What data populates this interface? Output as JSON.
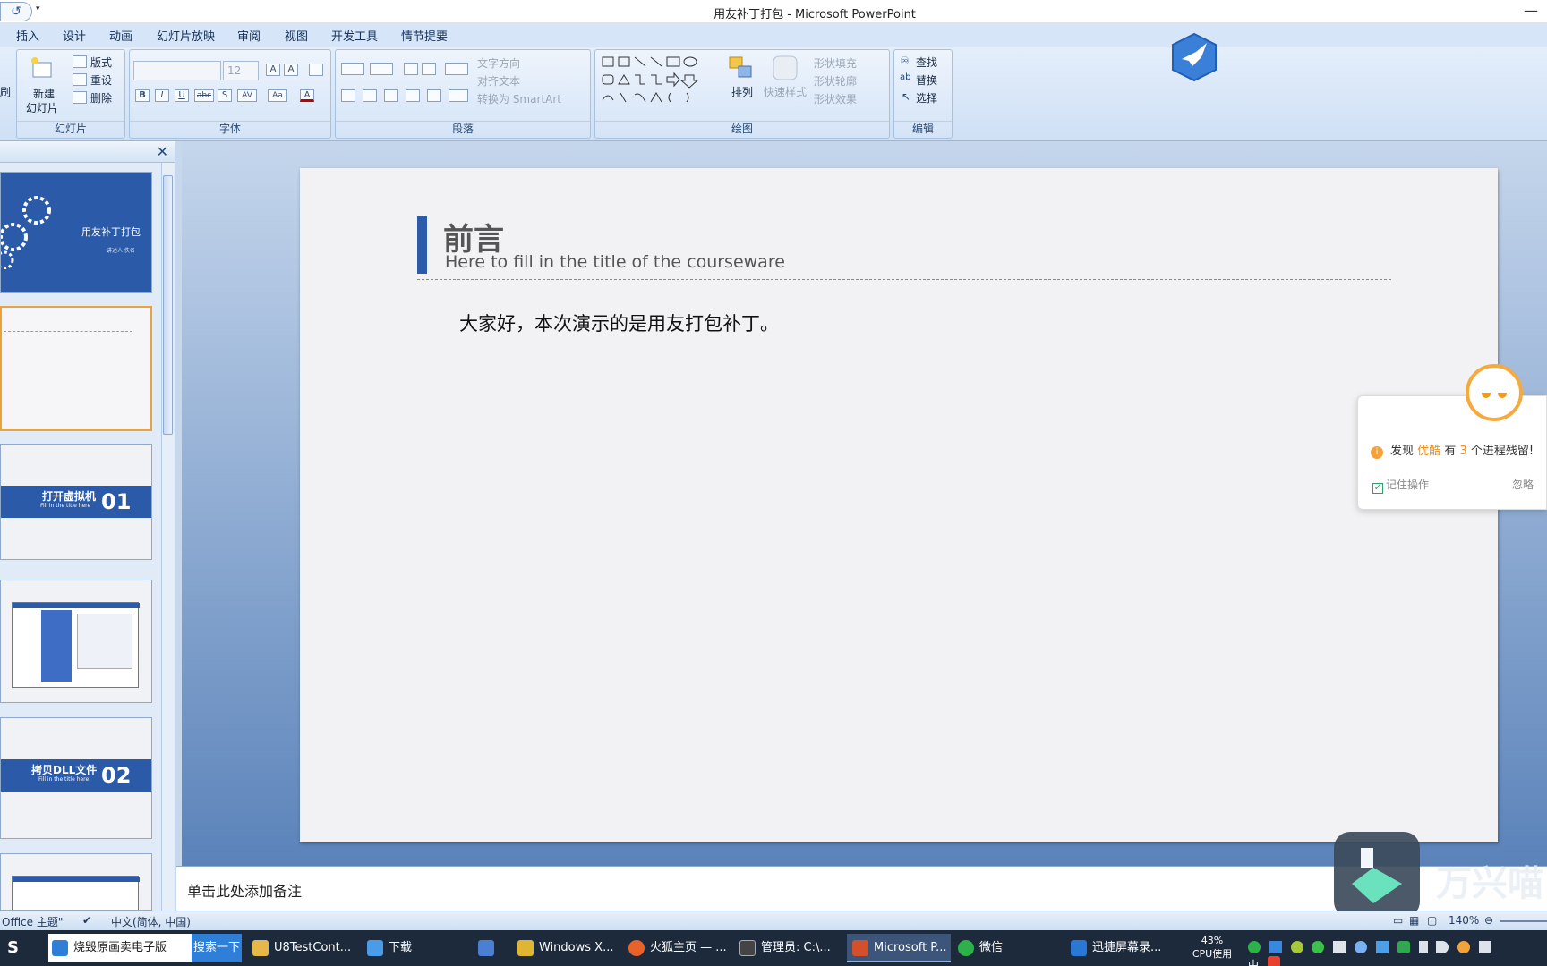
{
  "window": {
    "title": "用友补丁打包 - Microsoft PowerPoint",
    "undo_glyph": "↺",
    "qa_more": "▾",
    "minimize": "—"
  },
  "ribbon_tabs": [
    "插入",
    "设计",
    "动画",
    "幻灯片放映",
    "审阅",
    "视图",
    "开发工具",
    "情节提要"
  ],
  "ribbon": {
    "left_cut_label": "刷",
    "slides_group": {
      "label": "幻灯片",
      "new_slide": "新建",
      "new_slide_sub": "幻灯片",
      "layout": "版式",
      "reset": "重设",
      "delete": "删除"
    },
    "font_group": {
      "label": "字体",
      "font_name": "",
      "font_size": "12",
      "bold": "B",
      "italic": "I",
      "underline": "U",
      "strike": "abc",
      "shadow": "S",
      "spacing": "AV",
      "case": "Aa",
      "color": "A",
      "grow": "A",
      "shrink": "A"
    },
    "paragraph_group": {
      "label": "段落",
      "text_direction": "文字方向",
      "align_text": "对齐文本",
      "convert_smartart": "转换为 SmartArt"
    },
    "drawing_group": {
      "label": "绘图",
      "arrange": "排列",
      "quick_styles": "快速样式",
      "shape_fill": "形状填充",
      "shape_outline": "形状轮廓",
      "shape_effects": "形状效果"
    },
    "editing_group": {
      "label": "编辑",
      "find": "查找",
      "replace": "替换",
      "select": "选择"
    }
  },
  "slides_panel": {
    "close_glyph": "✕",
    "thumbnails": [
      {
        "kind": "title",
        "title": "用友补丁打包",
        "sub": "讲述人 佚名"
      },
      {
        "kind": "blank",
        "title": "",
        "sub": ""
      },
      {
        "kind": "section",
        "title": "打开虚拟机",
        "sub": "Fill in the title here",
        "num": "01"
      },
      {
        "kind": "screenshot",
        "title": "",
        "sub": ""
      },
      {
        "kind": "section",
        "title": "拷贝DLL文件",
        "sub": "Fill in the title here",
        "num": "02"
      },
      {
        "kind": "screenshot",
        "title": "",
        "sub": ""
      }
    ]
  },
  "slide": {
    "title": "前言",
    "subtitle": "Here to fill in the title of the courseware",
    "body": "大家好，本次演示的是用友打包补丁。"
  },
  "notes": {
    "placeholder": "单击此处添加备注"
  },
  "status": {
    "theme": "Office 主题\"",
    "language": "中文(简体, 中国)",
    "zoom": "140%"
  },
  "popup": {
    "msg_prefix": "发现",
    "app": "优酷",
    "msg_mid": "有",
    "count": "3",
    "msg_suffix": "个进程残留!",
    "remember": "记住操作",
    "ignore": "忽略"
  },
  "watermark": {
    "text": "万兴喵"
  },
  "taskbar": {
    "items": [
      {
        "label": "烧毁原画卖电子版",
        "color": "#2f7fd8"
      },
      {
        "label": "搜索一下",
        "color": ""
      },
      {
        "label": "U8TestCont...",
        "color": "#e6b84a"
      },
      {
        "label": "下载",
        "color": "#4a9be8"
      },
      {
        "label": "",
        "color": "#4a7fd1"
      },
      {
        "label": "Windows X...",
        "color": "#e0b531"
      },
      {
        "label": "火狐主页 — ...",
        "color": "#e8622a"
      },
      {
        "label": "管理员: C:\\...",
        "color": "#444"
      },
      {
        "label": "Microsoft P...",
        "color": "#d2502c"
      },
      {
        "label": "微信",
        "color": "#2db24a"
      },
      {
        "label": "迅捷屏幕录...",
        "color": "#2a78d6"
      }
    ],
    "cpu_percent": "43%",
    "cpu_label": "CPU使用",
    "ime": "中"
  },
  "colors": {
    "accent_blue": "#2c5ca9",
    "popup_orange": "#f7a93b"
  }
}
